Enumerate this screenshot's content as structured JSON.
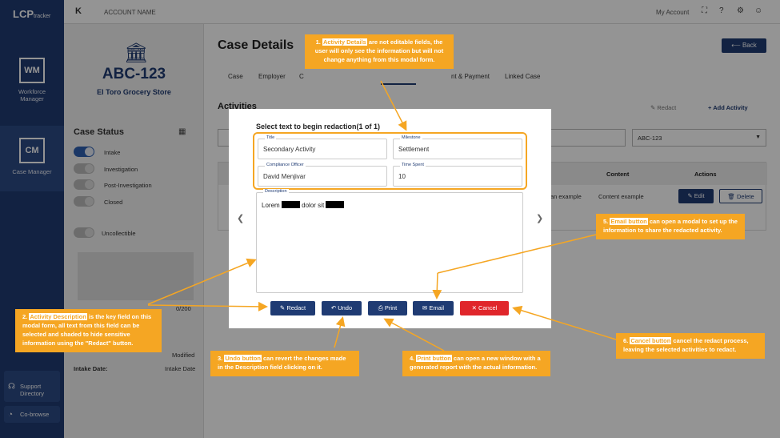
{
  "sidebar": {
    "logo": "LCP",
    "logo_sub": "tracker",
    "items": [
      {
        "abbr": "WM",
        "label": "Workforce\nManager"
      },
      {
        "abbr": "CM",
        "label": "Case Manager"
      }
    ],
    "support_label": "Support\nDirectory",
    "cobrowse_label": "Co-browse"
  },
  "topbar": {
    "collapse_icon": "K",
    "account_name": "ACCOUNT NAME",
    "my_account": "My Account"
  },
  "case": {
    "number": "ABC-123",
    "org": "El Toro Grocery Store",
    "status_title": "Case Status",
    "statuses": [
      {
        "label": "Intake",
        "on": true
      },
      {
        "label": "Investigation",
        "on": false
      },
      {
        "label": "Post-Investigation",
        "on": false
      },
      {
        "label": "Closed",
        "on": false
      }
    ],
    "uncollectible": "Uncollectible",
    "char_count": "0/200",
    "modified": "Modified",
    "intake_date_label": "Intake Date:",
    "intake_date_value": "Intake Date"
  },
  "main": {
    "title": "Case Details",
    "back": "Back",
    "tabs": [
      "Case",
      "Employer",
      "C",
      "nt & Payment",
      "Linked Case"
    ],
    "activities_title": "Activities",
    "redact": "Redact",
    "add_activity": "Add Activity",
    "filter_value": "ABC-123",
    "table_headers": [
      "e",
      "Content",
      "Actions"
    ],
    "row": {
      "col1": "is is an example",
      "content": "Content example",
      "edit": "Edit",
      "delete": "Delete"
    }
  },
  "modal": {
    "heading": "Select text to begin redaction(1 of 1)",
    "title_label": "Title",
    "title_value": "Secondary Activity",
    "milestone_label": "Milestone",
    "milestone_value": "Settlement",
    "officer_label": "Compliance Officer",
    "officer_value": "David Menjivar",
    "time_label": "Time Spent",
    "time_value": "10",
    "desc_label": "Description",
    "desc_word1": "Lorem",
    "desc_word2": "dolor sit",
    "buttons": {
      "redact": "Redact",
      "undo": "Undo",
      "print": "Print",
      "email": "Email",
      "cancel": "Cancel"
    }
  },
  "callouts": [
    {
      "hl": "Activity Details",
      "prefix": "1. ",
      "text": " are not editable fields, the user will only see the information but will not change anything from this modal form."
    },
    {
      "hl": "Activity Description",
      "prefix": "2. ",
      "text": " is the key field on this modal form, all text from this field can be selected and shaded to hide sensitive information using the \"Redact\" button."
    },
    {
      "hl": "Undo button",
      "prefix": "3. ",
      "text": " can revert the changes made in the Description field clicking on it."
    },
    {
      "hl": "Print button",
      "prefix": "4. ",
      "text": " can open a new window with a generated report with the actual information."
    },
    {
      "hl": "Email button",
      "prefix": "5. ",
      "text": " can open a modal to set up the information to share the redacted activity."
    },
    {
      "hl": "Cancel button",
      "prefix": "6. ",
      "text": " cancel the redact process, leaving the selected activities to redact."
    }
  ],
  "colors": {
    "navy": "#1f3b73",
    "orange": "#f5a623",
    "cancel_red": "#e0262b"
  }
}
